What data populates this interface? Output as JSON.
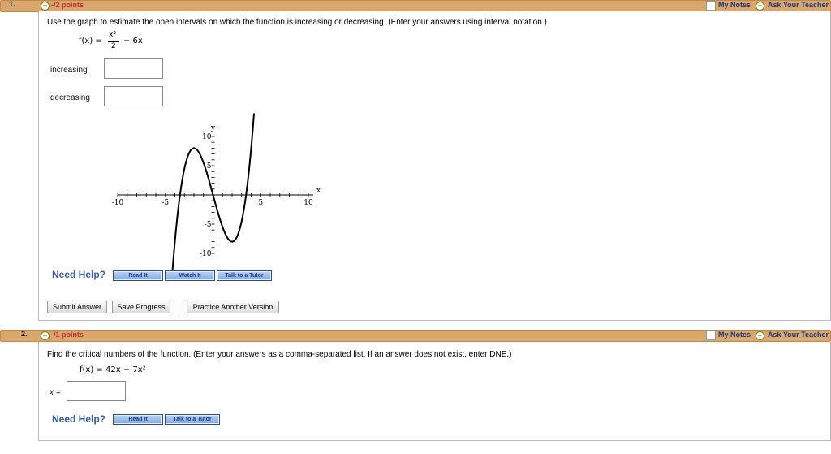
{
  "q1": {
    "number": "1.",
    "points": "-/2 points",
    "my_notes": "My Notes",
    "ask_teacher": "Ask Your Teacher",
    "question": "Use the graph to estimate the open intervals on which the function is increasing or decreasing. (Enter your answers using interval notation.)",
    "formula_lhs": "f(x) =",
    "formula_num": "x³",
    "formula_den": "2",
    "formula_rest": "− 6x",
    "increasing_label": "increasing",
    "decreasing_label": "decreasing",
    "increasing_value": "",
    "decreasing_value": "",
    "need_help": "Need Help?",
    "read_it": "Read It",
    "watch_it": "Watch It",
    "talk_tutor": "Talk to a Tutor",
    "submit": "Submit Answer",
    "save": "Save Progress",
    "practice": "Practice Another Version"
  },
  "q2": {
    "number": "2.",
    "points": "-/1 points",
    "my_notes": "My Notes",
    "ask_teacher": "Ask Your Teacher",
    "question": "Find the critical numbers of the function. (Enter your answers as a comma-separated list. If an answer does not exist, enter DNE.)",
    "formula": "f(x) = 42x − 7x²",
    "x_label": "x =",
    "x_value": "",
    "need_help": "Need Help?",
    "read_it": "Read It",
    "talk_tutor": "Talk to a Tutor"
  },
  "chart_data": {
    "type": "line",
    "function": "x^3/2 - 6x",
    "xlabel": "x",
    "ylabel": "y",
    "xlim": [
      -10,
      10
    ],
    "ylim": [
      -10,
      10
    ],
    "x_ticks": [
      "-10",
      "-5",
      "5",
      "10"
    ],
    "y_ticks": [
      "10",
      "5",
      "-5",
      "-10"
    ],
    "x": [
      -4.3,
      -4,
      -3.5,
      -3,
      -2.5,
      -2,
      -1.5,
      -1,
      -0.5,
      0,
      0.5,
      1,
      1.5,
      2,
      2.5,
      3,
      3.5,
      4,
      4.3
    ],
    "y": [
      -13.95,
      -8,
      -0.44,
      4.5,
      7.19,
      8,
      7.31,
      5.5,
      2.94,
      0,
      -2.94,
      -5.5,
      -7.31,
      -8,
      -7.19,
      -4.5,
      0.44,
      8,
      13.95
    ]
  }
}
